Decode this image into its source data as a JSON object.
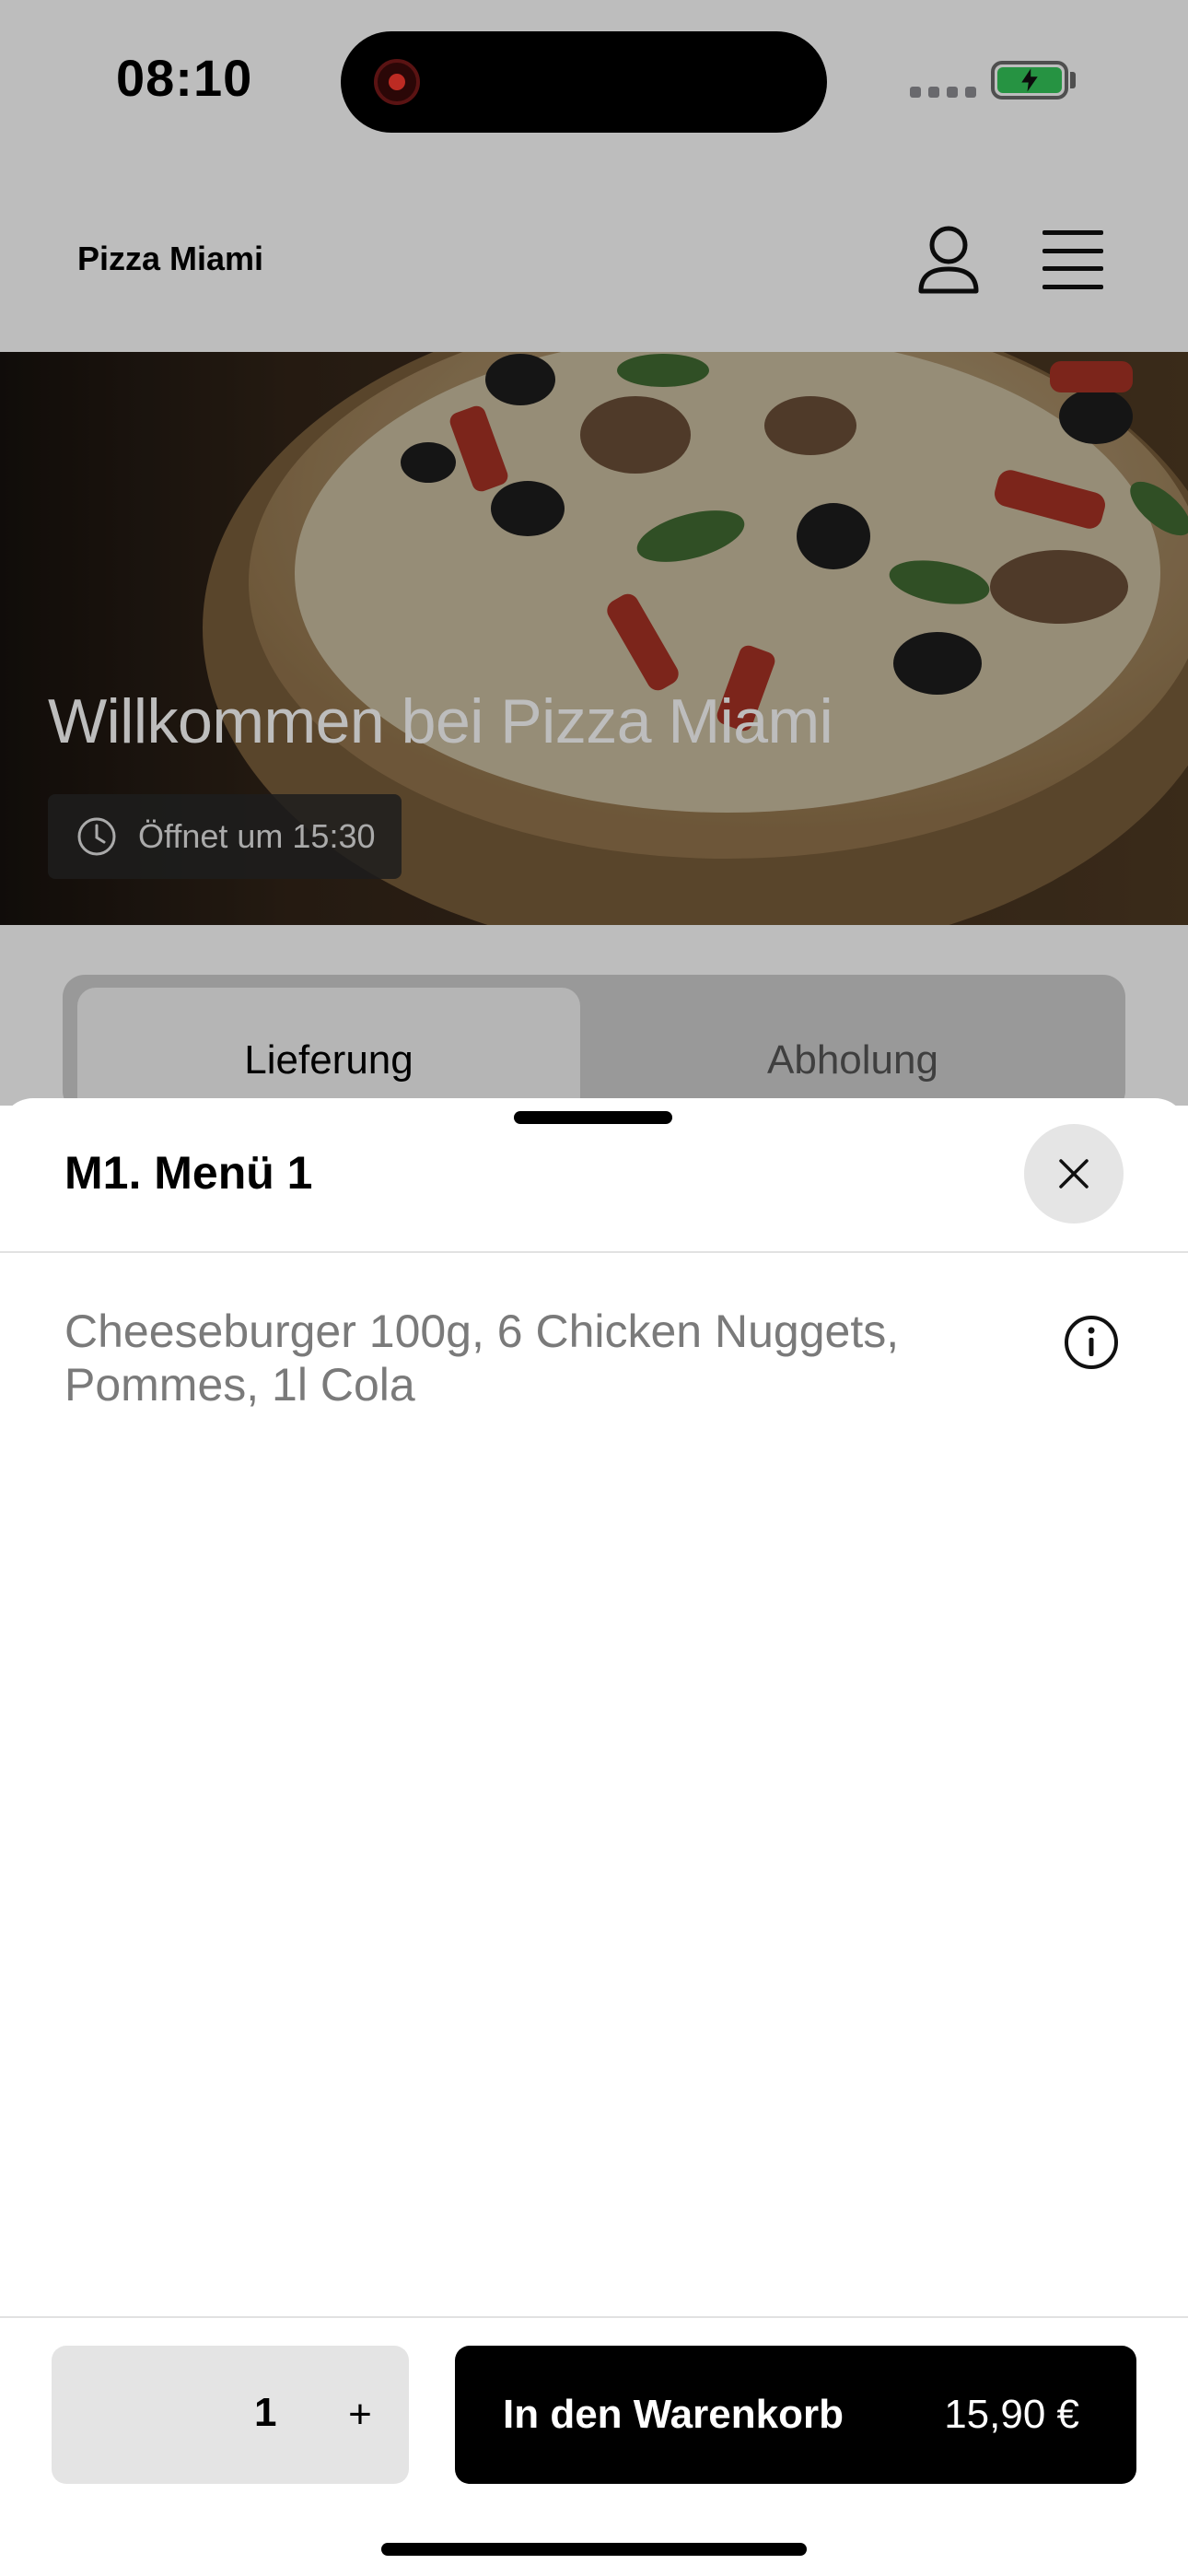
{
  "status_bar": {
    "time": "08:10",
    "battery_color": "#34c759",
    "recording_color": "#ff3b30"
  },
  "header": {
    "brand": "Pizza Miami",
    "user_icon": "user-icon",
    "menu_icon": "hamburger-menu-icon"
  },
  "hero": {
    "title": "Willkommen bei Pizza Miami",
    "hours_icon": "clock-icon",
    "hours_text": "Öffnet um 15:30"
  },
  "tabs": [
    {
      "label": "Lieferung",
      "active": true
    },
    {
      "label": "Abholung",
      "active": false
    }
  ],
  "sheet": {
    "title": "M1. Menü 1",
    "close_icon": "close-icon",
    "description": "Cheeseburger 100g, 6 Chicken Nuggets, Pommes, 1l Cola",
    "info_icon": "info-icon"
  },
  "footer": {
    "quantity": "1",
    "plus_label": "+",
    "cart_label": "In den Warenkorb",
    "price": "15,90 €",
    "accent": "#000000"
  }
}
